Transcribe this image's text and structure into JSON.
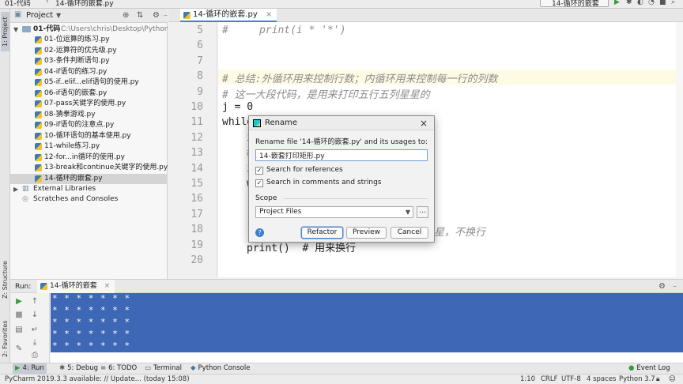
{
  "navbar": {
    "crumb1": "01-代码",
    "crumb2": "14-循环的嵌套.py",
    "run_config": "14-循环的嵌套"
  },
  "left_strip": {
    "project_tab": "1: Project",
    "structure_tab": "Z: Structure",
    "favorites_tab": "2: Favorites"
  },
  "project": {
    "title": "Project",
    "root_label": "01-代码",
    "root_path": "C:\\Users\\chris\\Desktop\\Python基础\\Day",
    "files": [
      "01-位运算的练习.py",
      "02-运算符的优先级.py",
      "03-条件判断语句.py",
      "04-if语句的练习.py",
      "05-if..elif...elif语句的使用.py",
      "06-if语句的嵌套.py",
      "07-pass关键字的使用.py",
      "08-猜拳游戏.py",
      "09-if语句的注意点.py",
      "10-循环语句的基本使用.py",
      "11-while练习.py",
      "12-for...in循环的使用.py",
      "13-break和continue关键字的使用.py",
      "14-循环的嵌套.py"
    ],
    "external_libraries": "External Libraries",
    "scratches": "Scratches and Consoles"
  },
  "editor": {
    "tab_label": "14-循环的嵌套.py",
    "lines": [
      {
        "num": "5",
        "text": "#     print(i * '*')",
        "kind": "comment",
        "indent": 0
      },
      {
        "num": "6",
        "text": "",
        "kind": "code",
        "indent": 0
      },
      {
        "num": "7",
        "text": "",
        "kind": "code",
        "indent": 0
      },
      {
        "num": "8",
        "text": "# 总结:外循环用来控制行数；内循环用来控制每一行的列数",
        "kind": "comment",
        "indent": 0
      },
      {
        "num": "9",
        "text": "# 这一大段代码，是用来打印五行五列星星的",
        "kind": "comment",
        "indent": 0
      },
      {
        "num": "10",
        "text": "j = 0",
        "kind": "code",
        "indent": 0
      },
      {
        "num": "11",
        "text": "while",
        "kind": "code",
        "indent": 0
      },
      {
        "num": "12",
        "text": "i",
        "kind": "code",
        "indent": 1
      },
      {
        "num": "13",
        "text": "#",
        "kind": "comment",
        "indent": 1
      },
      {
        "num": "14",
        "text": "i",
        "kind": "code",
        "indent": 1
      },
      {
        "num": "15",
        "text": "w",
        "kind": "code",
        "indent": 1
      },
      {
        "num": "16",
        "text": "",
        "kind": "code",
        "indent": 0
      },
      {
        "num": "17",
        "text": "",
        "kind": "code",
        "indent": 0
      },
      {
        "num": "18",
        "text": "个星星，不换行",
        "kind": "comment",
        "indent": 0
      },
      {
        "num": "19",
        "text": "print()  # 用来换行",
        "kind": "mixed",
        "indent": 1
      },
      {
        "num": "20",
        "text": "",
        "kind": "code",
        "indent": 0
      }
    ]
  },
  "dialog": {
    "title": "Rename",
    "prompt": "Rename file '14-循环的嵌套.py' and its usages to:",
    "input_value": "14-嵌套打印矩形.py",
    "search_references": "Search for references",
    "search_comments": "Search in comments and strings",
    "scope_label": "Scope",
    "scope_value": "Project Files",
    "more_label": "...",
    "refactor_label": "Refactor",
    "preview_label": "Preview",
    "cancel_label": "Cancel",
    "help_label": "?"
  },
  "run": {
    "label": "Run:",
    "tab_label": "14-循环的嵌套",
    "output_lines": [
      "* * * * * * *",
      "* * * * * * *",
      "* * * * * * *",
      "* * * * * * *",
      "* * * * * * *"
    ]
  },
  "bottom_tabs": {
    "run": "4: Run",
    "debug": "5: Debug",
    "todo": "6: TODO",
    "terminal": "Terminal",
    "python_console": "Python Console",
    "event_log": "Event Log"
  },
  "status": {
    "message": "PyCharm 2019.3.3 available: // Update... (today 15:08)",
    "position": "1:10",
    "line_sep": "CRLF",
    "encoding": "UTF-8",
    "indent": "4 spaces",
    "interpreter": "Python 3.7"
  },
  "colors": {
    "accent": "#4a7fc1",
    "selection": "#3e68b5",
    "highlight_line": "#fffae3",
    "comment": "#8c8c8c"
  }
}
